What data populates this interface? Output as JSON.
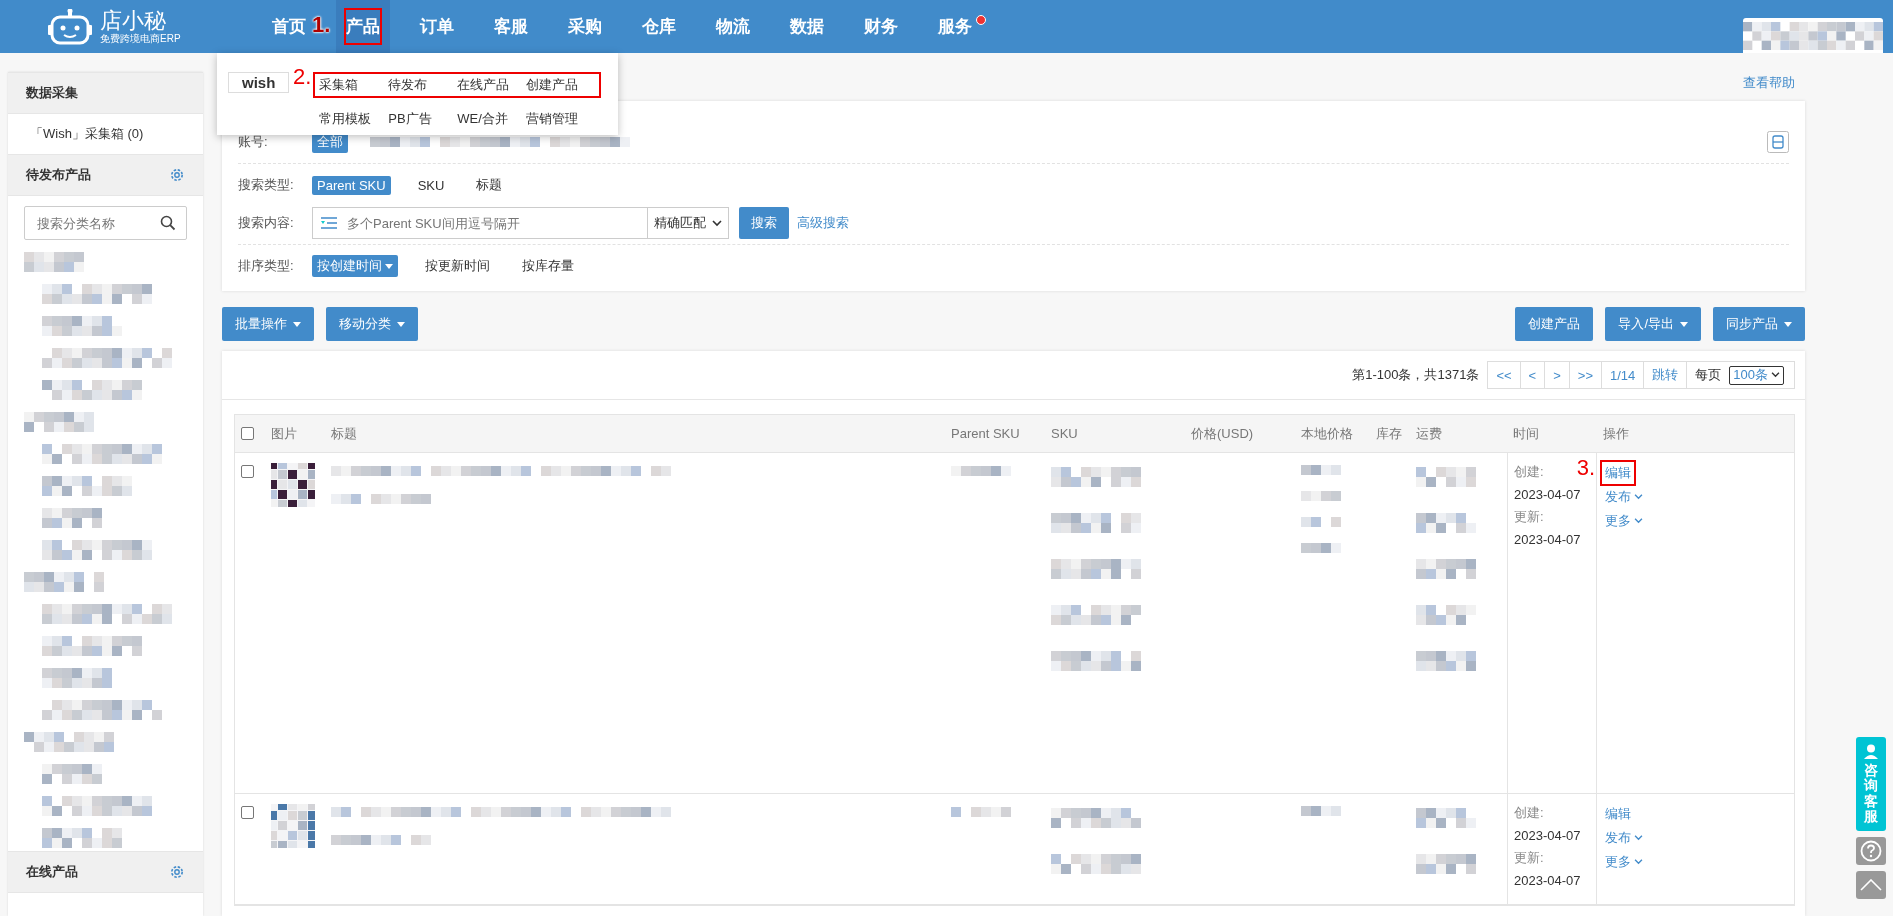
{
  "top_nav": {
    "logo": {
      "name": "店小秘",
      "tagline": "免费跨境电商ERP"
    },
    "items": [
      {
        "label": "首页",
        "selected": false,
        "badge": false
      },
      {
        "label": "产品",
        "selected": true,
        "badge": false,
        "annotation": "1."
      },
      {
        "label": "订单",
        "selected": false,
        "badge": false
      },
      {
        "label": "客服",
        "selected": false,
        "badge": false
      },
      {
        "label": "采购",
        "selected": false,
        "badge": false
      },
      {
        "label": "仓库",
        "selected": false,
        "badge": false
      },
      {
        "label": "物流",
        "selected": false,
        "badge": false
      },
      {
        "label": "数据",
        "selected": false,
        "badge": false
      },
      {
        "label": "财务",
        "selected": false,
        "badge": false
      },
      {
        "label": "服务",
        "selected": false,
        "badge": true
      }
    ]
  },
  "product_menu": {
    "platform": "wish",
    "rows": [
      {
        "annotation": "2.",
        "items": [
          "采集箱",
          "待发布",
          "在线产品",
          "创建产品"
        ]
      },
      {
        "items": [
          "常用模板",
          "PB广告",
          "WE/合并",
          "营销管理"
        ]
      }
    ]
  },
  "sidebar": {
    "sections": [
      {
        "title": "数据采集",
        "gear": false,
        "items": [
          "「Wish」采集箱 (0)"
        ]
      },
      {
        "title": "待发布产品",
        "gear": true,
        "search_placeholder": "搜索分类名称"
      },
      {
        "title": "在线产品",
        "gear": true
      }
    ]
  },
  "help_link": "查看帮助",
  "filters": {
    "account": {
      "label": "账号:",
      "options": [
        {
          "label": "全部",
          "selected": true
        }
      ]
    },
    "search_type": {
      "label": "搜索类型:",
      "options": [
        {
          "label": "Parent SKU",
          "selected": true
        },
        {
          "label": "SKU",
          "selected": false
        },
        {
          "label": "标题",
          "selected": false
        }
      ]
    },
    "search_content": {
      "label": "搜索内容:",
      "placeholder": "多个Parent SKU间用逗号隔开",
      "match": "精确匹配",
      "button": "搜索",
      "advanced": "高级搜索"
    },
    "sort": {
      "label": "排序类型:",
      "options": [
        {
          "label": "按创建时间",
          "selected": true
        },
        {
          "label": "按更新时间",
          "selected": false
        },
        {
          "label": "按库存量",
          "selected": false
        }
      ]
    }
  },
  "toolbar": {
    "left": [
      {
        "label": "批量操作",
        "dropdown": true
      },
      {
        "label": "移动分类",
        "dropdown": true
      }
    ],
    "right": [
      {
        "label": "创建产品",
        "dropdown": false
      },
      {
        "label": "导入/导出",
        "dropdown": true
      },
      {
        "label": "同步产品",
        "dropdown": true
      }
    ]
  },
  "pagination": {
    "summary": "第1-100条，共1371条",
    "buttons": [
      "<<",
      "<",
      ">",
      ">>",
      "1/14",
      "跳转"
    ],
    "per_page_label": "每页",
    "per_page": "100条"
  },
  "table": {
    "header_checked": false,
    "columns": [
      "图片",
      "标题",
      "Parent SKU",
      "SKU",
      "价格(USD)",
      "本地价格",
      "库存",
      "运费",
      "时间",
      "操作"
    ],
    "rows": [
      {
        "checked": false,
        "created_label": "创建:",
        "created": "2023-04-07",
        "updated_label": "更新:",
        "updated": "2023-04-07",
        "actions": [
          {
            "label": "编辑",
            "dropdown": false,
            "annotation": "3."
          },
          {
            "label": "发布",
            "dropdown": true
          },
          {
            "label": "更多",
            "dropdown": true
          }
        ]
      },
      {
        "checked": false,
        "created_label": "创建:",
        "created": "2023-04-07",
        "updated_label": "更新:",
        "updated": "2023-04-07",
        "actions": [
          {
            "label": "编辑",
            "dropdown": false
          },
          {
            "label": "发布",
            "dropdown": true
          },
          {
            "label": "更多",
            "dropdown": true
          }
        ]
      }
    ]
  },
  "float_buttons": {
    "support": "咨询客服"
  }
}
